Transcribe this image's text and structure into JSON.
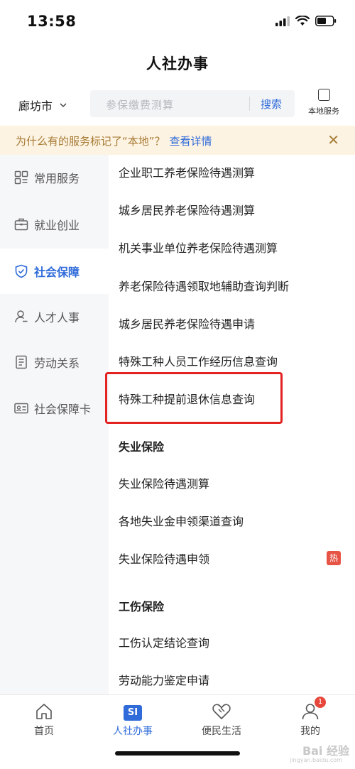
{
  "status": {
    "time": "13:58"
  },
  "nav": {
    "title": "人社办事"
  },
  "search": {
    "city": "廊坊市",
    "placeholder": "参保缴费测算",
    "button": "搜索",
    "local_service": "本地服务"
  },
  "notice": {
    "text": "为什么有的服务标记了“本地”？",
    "link": "查看详情"
  },
  "sidebar": {
    "items": [
      {
        "label": "常用服务",
        "icon": "grid-icon"
      },
      {
        "label": "就业创业",
        "icon": "briefcase-icon"
      },
      {
        "label": "社会保障",
        "icon": "shield-check-icon",
        "active": true
      },
      {
        "label": "人才人事",
        "icon": "person-icon"
      },
      {
        "label": "劳动关系",
        "icon": "document-icon"
      },
      {
        "label": "社会保障卡",
        "icon": "id-card-icon"
      }
    ]
  },
  "services": {
    "items": [
      "企业职工养老保险待遇测算",
      "城乡居民养老保险待遇测算",
      "机关事业单位养老保险待遇测算",
      "养老保险待遇领取地辅助查询判断",
      "城乡居民养老保险待遇申请",
      "特殊工种人员工作经历信息查询",
      "特殊工种提前退休信息查询"
    ],
    "unemployment_heading": "失业保险",
    "unemployment_items": [
      "失业保险待遇测算",
      "各地失业金申领渠道查询",
      "失业保险待遇申领"
    ],
    "hot_badge": "热",
    "injury_heading": "工伤保险",
    "injury_items": [
      "工伤认定结论查询",
      "劳动能力鉴定申请"
    ]
  },
  "tabbar": {
    "tabs": [
      {
        "label": "首页",
        "icon": "home-icon"
      },
      {
        "label": "人社办事",
        "icon": "si-icon",
        "icon_text": "SI",
        "active": true
      },
      {
        "label": "便民生活",
        "icon": "handshake-icon"
      },
      {
        "label": "我的",
        "icon": "user-icon",
        "badge": "1"
      }
    ]
  },
  "watermark": {
    "text": "Bai 经验",
    "sub": "jingyan.baidu.com"
  },
  "colors": {
    "accent": "#2f6bd9",
    "notice_bg": "#fdf3e2",
    "notice_text": "#a77b35",
    "highlight": "#e32222",
    "hot": "#e75344"
  }
}
